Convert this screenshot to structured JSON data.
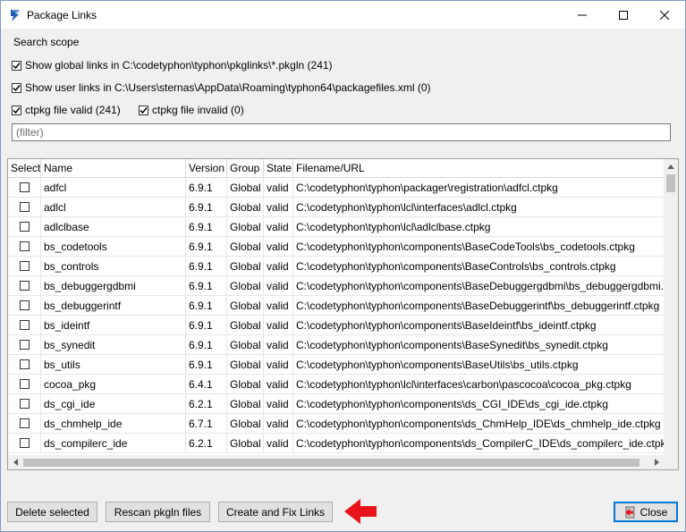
{
  "window": {
    "title": "Package Links",
    "brand_color": "#1e5fb4",
    "accent_arrow_color": "#e8141b"
  },
  "search_scope": {
    "group_label": "Search scope",
    "show_global_label": "Show global links in C:\\codetyphon\\typhon\\pkglinks\\*.pkgln (241)",
    "show_global_checked": true,
    "show_user_label": "Show user links in C:\\Users\\sternas\\AppData\\Roaming\\typhon64\\packagefiles.xml (0)",
    "show_user_checked": true,
    "valid_label": "ctpkg file valid (241)",
    "valid_checked": true,
    "invalid_label": "ctpkg file invalid (0)",
    "invalid_checked": true
  },
  "filter": {
    "placeholder": "(filter)",
    "value": ""
  },
  "grid": {
    "columns": [
      "Select",
      "Name",
      "Version",
      "Group",
      "State",
      "Filename/URL"
    ],
    "rows": [
      {
        "name": "adfcl",
        "version": "6.9.1",
        "group": "Global",
        "state": "valid",
        "file": "C:\\codetyphon\\typhon\\packager\\registration\\adfcl.ctpkg"
      },
      {
        "name": "adlcl",
        "version": "6.9.1",
        "group": "Global",
        "state": "valid",
        "file": "C:\\codetyphon\\typhon\\lcl\\interfaces\\adlcl.ctpkg"
      },
      {
        "name": "adlclbase",
        "version": "6.9.1",
        "group": "Global",
        "state": "valid",
        "file": "C:\\codetyphon\\typhon\\lcl\\adlclbase.ctpkg"
      },
      {
        "name": "bs_codetools",
        "version": "6.9.1",
        "group": "Global",
        "state": "valid",
        "file": "C:\\codetyphon\\typhon\\components\\BaseCodeTools\\bs_codetools.ctpkg"
      },
      {
        "name": "bs_controls",
        "version": "6.9.1",
        "group": "Global",
        "state": "valid",
        "file": "C:\\codetyphon\\typhon\\components\\BaseControls\\bs_controls.ctpkg"
      },
      {
        "name": "bs_debuggergdbmi",
        "version": "6.9.1",
        "group": "Global",
        "state": "valid",
        "file": "C:\\codetyphon\\typhon\\components\\BaseDebuggergdbmi\\bs_debuggergdbmi.ctpkg"
      },
      {
        "name": "bs_debuggerintf",
        "version": "6.9.1",
        "group": "Global",
        "state": "valid",
        "file": "C:\\codetyphon\\typhon\\components\\BaseDebuggerintf\\bs_debuggerintf.ctpkg"
      },
      {
        "name": "bs_ideintf",
        "version": "6.9.1",
        "group": "Global",
        "state": "valid",
        "file": "C:\\codetyphon\\typhon\\components\\BaseIdeintf\\bs_ideintf.ctpkg"
      },
      {
        "name": "bs_synedit",
        "version": "6.9.1",
        "group": "Global",
        "state": "valid",
        "file": "C:\\codetyphon\\typhon\\components\\BaseSynedit\\bs_synedit.ctpkg"
      },
      {
        "name": "bs_utils",
        "version": "6.9.1",
        "group": "Global",
        "state": "valid",
        "file": "C:\\codetyphon\\typhon\\components\\BaseUtils\\bs_utils.ctpkg"
      },
      {
        "name": "cocoa_pkg",
        "version": "6.4.1",
        "group": "Global",
        "state": "valid",
        "file": "C:\\codetyphon\\typhon\\lcl\\interfaces\\carbon\\pascocoa\\cocoa_pkg.ctpkg"
      },
      {
        "name": "ds_cgi_ide",
        "version": "6.2.1",
        "group": "Global",
        "state": "valid",
        "file": "C:\\codetyphon\\typhon\\components\\ds_CGI_IDE\\ds_cgi_ide.ctpkg"
      },
      {
        "name": "ds_chmhelp_ide",
        "version": "6.7.1",
        "group": "Global",
        "state": "valid",
        "file": "C:\\codetyphon\\typhon\\components\\ds_ChmHelp_IDE\\ds_chmhelp_ide.ctpkg"
      },
      {
        "name": "ds_compilerc_ide",
        "version": "6.2.1",
        "group": "Global",
        "state": "valid",
        "file": "C:\\codetyphon\\typhon\\components\\ds_CompilerC_IDE\\ds_compilerc_ide.ctpkg"
      }
    ]
  },
  "buttons": {
    "delete_selected": "Delete selected",
    "rescan": "Rescan pkgln files",
    "create_fix": "Create and Fix Links",
    "close": "Close"
  }
}
